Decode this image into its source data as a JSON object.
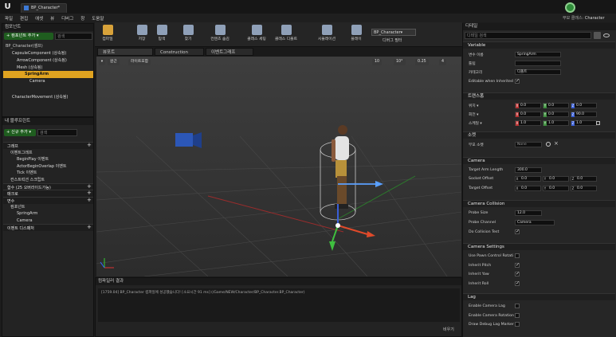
{
  "window": {
    "doc_tab": "BP_Character*",
    "engine_label": "부모 클래스:",
    "engine_value": "Character"
  },
  "menu": [
    "파일",
    "편집",
    "애셋",
    "뷰",
    "디버그",
    "창",
    "도움말"
  ],
  "toolbar": {
    "buttons": [
      "컴파일",
      "저장",
      "탐색",
      "찾기",
      "클래스 세팅",
      "클래스 디폴트",
      "시뮬레이션",
      "플레이"
    ],
    "extra": [
      "컨텐츠 숨김"
    ],
    "debug_select": "BP_Character▾",
    "debug_filter": "디버그 필터"
  },
  "components": {
    "title": "컴포넌트",
    "add_label": "+ 컴포넌트 추가 ▾",
    "search_placeholder": "검색",
    "tree": [
      "BP_Character(셀프)",
      "CapsuleComponent (상속됨)",
      "ArrowComponent (상속됨)",
      "Mesh (상속됨)",
      "SpringArm",
      "Camera",
      "CharacterMovement (상속됨)"
    ]
  },
  "mybp": {
    "title": "내 블루프린트",
    "add_label": "+ 신규 추가 ▾",
    "search_placeholder": "검색",
    "items": [
      {
        "t": "그래프",
        "k": "h"
      },
      {
        "t": "이벤트그래프",
        "k": "s"
      },
      {
        "t": "BeginPlay 이벤트",
        "k": "i"
      },
      {
        "t": "ActorBeginOverlap 이벤트",
        "k": "i"
      },
      {
        "t": "Tick 이벤트",
        "k": "i"
      },
      {
        "t": "컨스트럭션 스크립트",
        "k": "s"
      },
      {
        "t": "함수 (25 오버라이드가능)",
        "k": "h"
      },
      {
        "t": "매크로",
        "k": "h"
      },
      {
        "t": "변수",
        "k": "h"
      },
      {
        "t": "컴포넌트",
        "k": "s"
      },
      {
        "t": "SpringArm",
        "k": "i"
      },
      {
        "t": "Camera",
        "k": "i"
      },
      {
        "t": "이벤트 디스패처",
        "k": "h"
      }
    ]
  },
  "tabs": [
    "뷰포트",
    "Construction Script",
    "이벤트그래프"
  ],
  "viewport": {
    "view_mode": "원근",
    "lit_mode": "라이트포함",
    "snap_values": [
      "10",
      "10°",
      "0.25",
      "4"
    ]
  },
  "compiler": {
    "title": "컴파일러 결과",
    "log": "[1759.04] BP_Character 컴파일에 성공했습니다! [소요시간 91 ms] (/Game/NEW/Character/BP_Character.BP_Character)",
    "clear": "비우기"
  },
  "details": {
    "title": "디테일",
    "search_placeholder": "디테일 검색",
    "variable": {
      "section": "Variable",
      "name_label": "변수 이름",
      "name_value": "SpringArm",
      "tooltip_label": "툴팁",
      "category_label": "카테고리",
      "category_value": "디폴트",
      "editable_label": "Editable when Inherited"
    },
    "transform": {
      "section": "트랜스폼",
      "loc_label": "위치 ▾",
      "rot_label": "회전 ▾",
      "scale_label": "스케일 ▾",
      "loc": [
        "0.0",
        "0.0",
        "0.0"
      ],
      "rot": [
        "0.0",
        "0.0",
        "90.0"
      ],
      "scale": [
        "1.0",
        "1.0",
        "1.0"
      ]
    },
    "socket": {
      "section": "소켓",
      "parent_label": "부모 소켓",
      "parent_value": "None"
    },
    "camera": {
      "section": "Camera",
      "arm_label": "Target Arm Length",
      "arm_value": "300.0",
      "socket_offset_label": "Socket Offset",
      "target_offset_label": "Target Offset",
      "socket_offset": [
        "0.0",
        "0.0",
        "0.0"
      ],
      "target_offset": [
        "0.0",
        "0.0",
        "0.0"
      ]
    },
    "collision": {
      "section": "Camera Collision",
      "probe_size_label": "Probe Size",
      "probe_size_value": "12.0",
      "probe_channel_label": "Probe Channel",
      "probe_channel_value": "Camera",
      "do_test_label": "Do Collision Test"
    },
    "settings": {
      "section": "Camera Settings",
      "items": [
        "Use Pawn Control Rotati",
        "Inherit Pitch",
        "Inherit Yaw",
        "Inherit Roll"
      ],
      "checked": [
        false,
        true,
        true,
        true
      ]
    },
    "lag": {
      "section": "Lag",
      "items": [
        "Enable Camera Lag",
        "Enable Camera Rotation",
        "Draw Debug Lag Marker"
      ],
      "checked": [
        false,
        false,
        false
      ]
    }
  }
}
